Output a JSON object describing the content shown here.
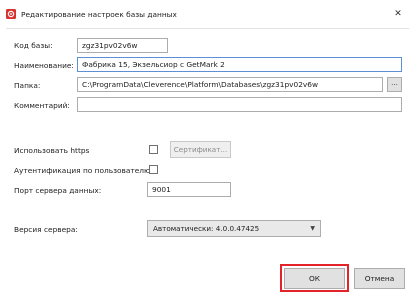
{
  "window": {
    "title": "Редактирование настроек базы данных",
    "close_glyph": "✕"
  },
  "form": {
    "db_code_label": "Код базы:",
    "db_code_value": "zgz31pv02v6w",
    "name_label": "Наименование:",
    "name_value": "Фабрика 15, Экзельсиор с GetMark 2",
    "folder_label": "Папка:",
    "folder_value": "C:\\ProgramData\\Cleverence\\Platform\\Databases\\zgz31pv02v6w",
    "browse_label": "...",
    "comment_label": "Комментарий:",
    "comment_value": "",
    "https_label": "Использовать https",
    "https_checked": false,
    "certificate_button": "Сертификат...",
    "user_auth_label": "Аутентификация по пользователю",
    "user_auth_checked": false,
    "port_label": "Порт сервера данных:",
    "port_value": "9001",
    "server_version_label": "Версия сервера:",
    "server_version_value": "Автоматически: 4.0.0.47425"
  },
  "buttons": {
    "ok": "ОК",
    "cancel": "Отмена"
  },
  "colors": {
    "highlight": "#e2232a",
    "accent": "#5c8fd6"
  }
}
